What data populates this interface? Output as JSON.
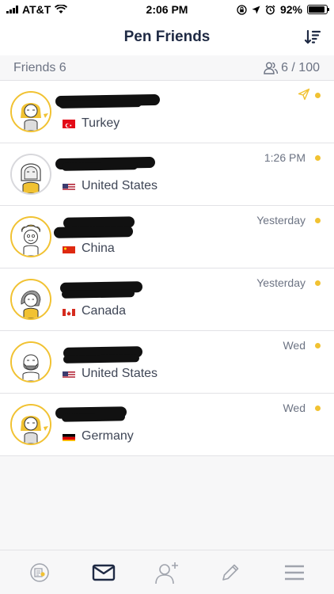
{
  "status_bar": {
    "carrier": "AT&T",
    "time": "2:06 PM",
    "battery": "92%",
    "battery_level": 0.92
  },
  "header": {
    "title": "Pen Friends",
    "sort_icon": "sort-descending-icon"
  },
  "sub_header": {
    "friends_label": "Friends 6",
    "quota": "6 / 100",
    "quota_icon": "people-icon"
  },
  "friends": [
    {
      "country": "Turkey",
      "time": "",
      "status_icon": "sent-icon",
      "unread": true,
      "flag": "turkey"
    },
    {
      "country": "United States",
      "time": "1:26 PM",
      "unread": true,
      "flag": "usa"
    },
    {
      "country": "China",
      "time": "Yesterday",
      "unread": true,
      "flag": "china"
    },
    {
      "country": "Canada",
      "time": "Yesterday",
      "unread": true,
      "flag": "canada"
    },
    {
      "country": "United States",
      "time": "Wed",
      "unread": true,
      "flag": "usa"
    },
    {
      "country": "Germany",
      "time": "Wed",
      "unread": true,
      "flag": "germany"
    }
  ],
  "tab_bar": {
    "tabs": [
      {
        "icon": "stamp-icon",
        "active": false
      },
      {
        "icon": "mail-icon",
        "active": true
      },
      {
        "icon": "add-friend-icon",
        "active": false
      },
      {
        "icon": "pencil-icon",
        "active": false
      },
      {
        "icon": "menu-icon",
        "active": false
      }
    ]
  },
  "colors": {
    "accent": "#f1c232",
    "navy": "#1f2a44",
    "muted": "#6c7383",
    "tab_inactive": "#a0a4ad"
  }
}
